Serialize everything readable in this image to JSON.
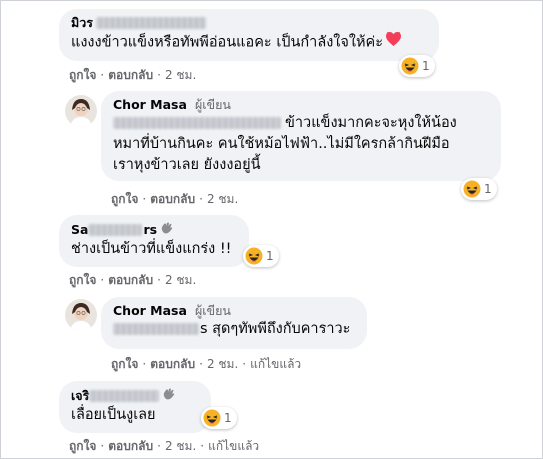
{
  "comments": [
    {
      "author": "มิวร",
      "text": "แงงงข้าวแข็งหรือทัพพีอ่อนแอคะ เป็นกำลังใจให้ค่ะ",
      "reaction_count": "1",
      "actions": {
        "like": "ถูกใจ",
        "reply": "ตอบกลับ",
        "time": "2 ชม."
      }
    },
    {
      "author": "Chor Masa",
      "badge": "ผู้เขียน",
      "text_line1_tail": "ข้าวแข็งมากคะจะหุงให้น้อง",
      "text_line2": "หมาที่บ้านกินคะ คนใช้หม้อไฟฟ้า..ไม่มีใครกล้ากินฝีมือ",
      "text_line3": "เราหุงข้าวเลย ยังงงอยู่นี้",
      "reaction_count": "1",
      "actions": {
        "like": "ถูกใจ",
        "reply": "ตอบกลับ",
        "time": "2 ชม."
      }
    },
    {
      "author": "Sa",
      "author_tail": "rs",
      "text": "ช่างเป็นข้าวที่แข็งแกร่ง !!",
      "reaction_count": "1",
      "actions": {
        "like": "ถูกใจ",
        "reply": "ตอบกลับ",
        "time": "2 ชม."
      }
    },
    {
      "author": "Chor Masa",
      "badge": "ผู้เขียน",
      "text_tail": "s สุดๆทัพพีถึงกับคาราวะ",
      "actions": {
        "like": "ถูกใจ",
        "reply": "ตอบกลับ",
        "time": "2 ชม.",
        "edited": "แก้ไขแล้ว"
      }
    },
    {
      "author": "เจริ",
      "text": "เลื่อยเป็นงูเลย",
      "reaction_count": "1",
      "actions": {
        "like": "ถูกใจ",
        "reply": "ตอบกลับ",
        "time": "2 ชม.",
        "edited": "แก้ไขแล้ว"
      }
    }
  ],
  "colors": {
    "bubble": "#f0f2f5",
    "meta": "#65676b",
    "text": "#050505",
    "haha": "#f7b125",
    "heart": "#f33e58"
  },
  "icons": {
    "reaction": "haha-emoji-icon",
    "heart": "heart-emoji-icon",
    "wave": "waving-hand-icon"
  }
}
